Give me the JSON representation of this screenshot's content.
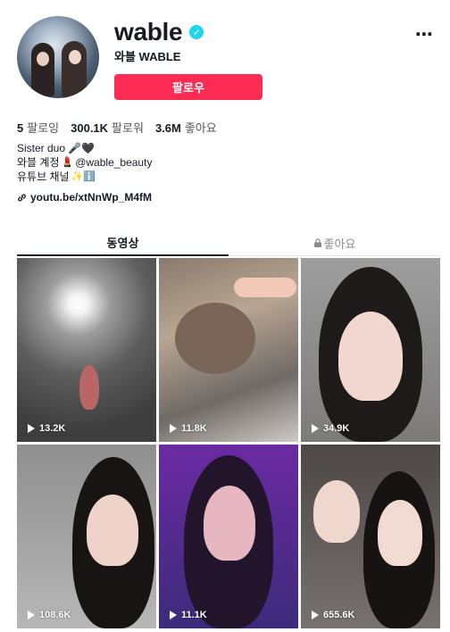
{
  "profile": {
    "username": "wable",
    "nickname": "와블 WABLE",
    "follow_label": "팔로우",
    "more_label": "⋯"
  },
  "stats": [
    {
      "value": "5",
      "label": "팔로잉"
    },
    {
      "value": "300.1K",
      "label": "팔로워"
    },
    {
      "value": "3.6M",
      "label": "좋아요"
    }
  ],
  "bio": {
    "line1": "Sister duo 🎤🖤",
    "line2_prefix": "와블 계정",
    "line2_emoji": "💄",
    "line2_handle": "@wable_beauty",
    "line3_prefix": "유튜브 채널",
    "line3_emoji": "✨ℹ️"
  },
  "link": {
    "text": "youtu.be/xtNnWp_M4fM"
  },
  "tabs": [
    {
      "label": "동영상",
      "active": true
    },
    {
      "label": "좋아요",
      "active": false,
      "locked": true
    }
  ],
  "videos": [
    {
      "views": "13.2K"
    },
    {
      "views": "11.8K"
    },
    {
      "views": "34.9K"
    },
    {
      "views": "108.6K"
    },
    {
      "views": "11.1K"
    },
    {
      "views": "655.6K"
    }
  ],
  "colors": {
    "accent": "#fe2c55",
    "verified": "#20d5ec",
    "text": "#161823"
  }
}
